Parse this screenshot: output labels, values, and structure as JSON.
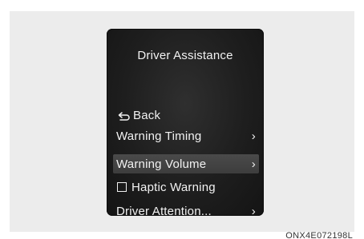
{
  "menu": {
    "title": "Driver Assistance",
    "items": [
      {
        "label": "Back",
        "icon": "back-arrow-icon"
      },
      {
        "label": "Warning Timing",
        "icon": "chevron-right-icon"
      },
      {
        "label": "Warning Volume",
        "icon": "chevron-right-icon",
        "selected": true
      },
      {
        "label": "Haptic Warning",
        "icon": "checkbox-unchecked-icon",
        "checked": false
      },
      {
        "label": "Driver Attention...",
        "icon": "chevron-right-icon"
      }
    ],
    "chevron": "›"
  },
  "caption": "ONX4E072198L",
  "colors": {
    "screen_bg": "#1e1e1e",
    "text": "#f2f2f2",
    "selected_row": "#444444",
    "backdrop": "#ececec"
  }
}
